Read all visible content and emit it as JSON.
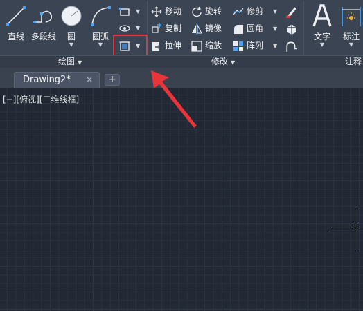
{
  "ribbon": {
    "draw": {
      "title": "绘图",
      "line_label": "直线",
      "polyline_label": "多段线",
      "circle_label": "圆",
      "arc_label": "圆弧"
    },
    "modify": {
      "title": "修改",
      "move_label": "移动",
      "copy_label": "复制",
      "stretch_label": "拉伸",
      "rotate_label": "旋转",
      "mirror_label": "镜像",
      "scale_label": "缩放",
      "trim_label": "修剪",
      "fillet_label": "圆角",
      "array_label": "阵列"
    },
    "annotation": {
      "title": "注释",
      "text_label": "文字",
      "dimension_label": "标注"
    }
  },
  "tabs": {
    "document_name": "Drawing2*",
    "close_glyph": "×",
    "add_glyph": "+"
  },
  "canvas": {
    "viewport_label": "[−][俯视][二维线框]"
  },
  "colors": {
    "highlight": "#e8353a",
    "ribbon_bg": "#3b4453",
    "canvas_bg": "#222934"
  }
}
